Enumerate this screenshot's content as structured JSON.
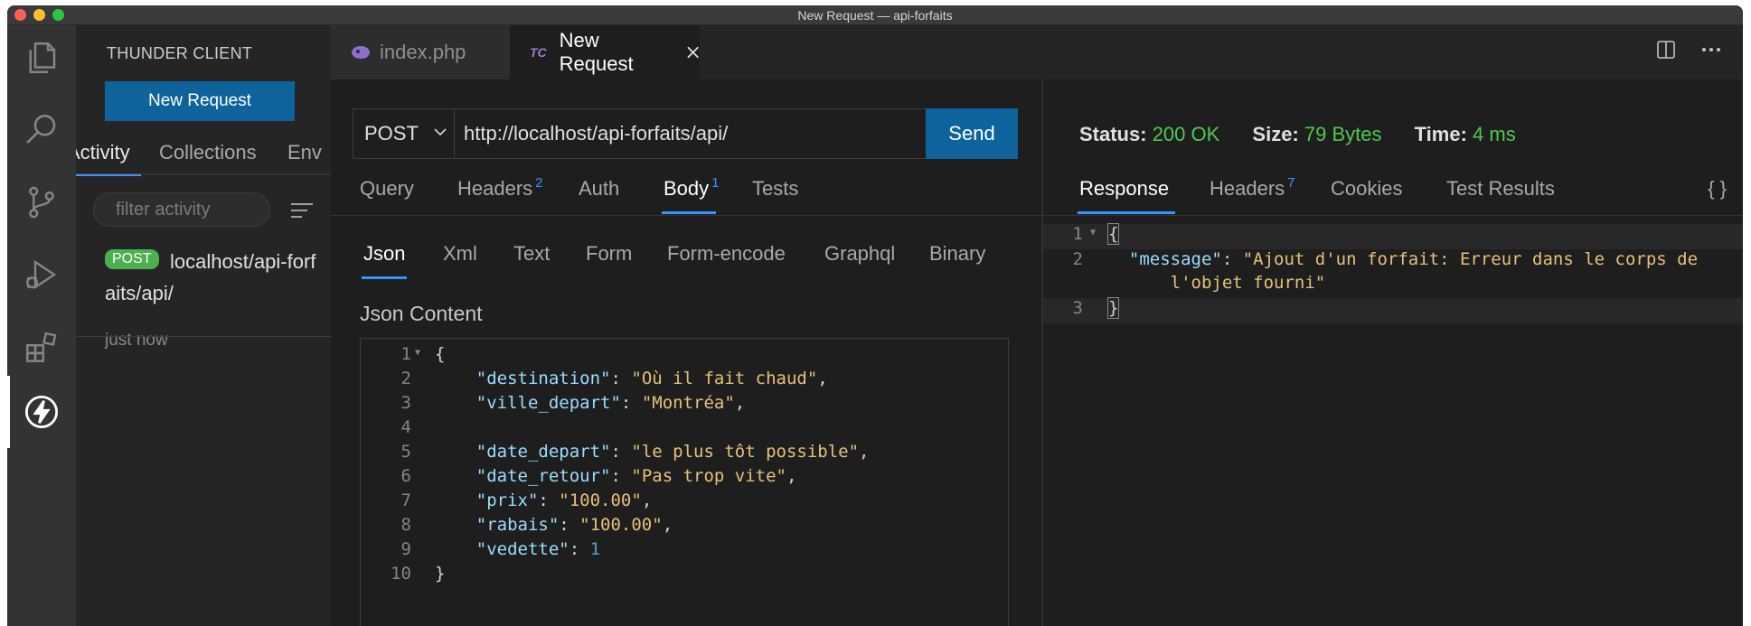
{
  "window": {
    "title": "New Request — api-forfaits"
  },
  "activity_bar": {
    "icons": [
      "files-icon",
      "search-icon",
      "source-control-icon",
      "run-debug-icon",
      "extensions-icon",
      "thunder-client-icon"
    ]
  },
  "sidebar": {
    "title": "THUNDER CLIENT",
    "new_request_label": "New Request",
    "tabs": [
      "Activity",
      "Collections",
      "Env"
    ],
    "filter_placeholder": "filter activity",
    "activity": {
      "method": "POST",
      "url": "localhost/api-forfaits/api/",
      "time": "just now"
    }
  },
  "editor_tabs": [
    {
      "label": "index.php",
      "icon": "php-icon"
    },
    {
      "label": "New Request",
      "icon": "tc-icon",
      "icon_text": "TC"
    }
  ],
  "request": {
    "method": "POST",
    "url": "http://localhost/api-forfaits/api/",
    "send_label": "Send",
    "tabs": [
      {
        "label": "Query",
        "count": ""
      },
      {
        "label": "Headers",
        "count": "2"
      },
      {
        "label": "Auth",
        "count": ""
      },
      {
        "label": "Body",
        "count": "1"
      },
      {
        "label": "Tests",
        "count": ""
      }
    ],
    "body_tabs": [
      "Json",
      "Xml",
      "Text",
      "Form",
      "Form-encode",
      "Graphql",
      "Binary"
    ],
    "json_label": "Json Content",
    "json_lines": [
      "{",
      "    \"destination\": \"Où il fait chaud\",",
      "    \"ville_depart\": \"Montréa\",",
      "",
      "    \"date_depart\": \"le plus tôt possible\",",
      "    \"date_retour\": \"Pas trop vite\",",
      "    \"prix\": \"100.00\",",
      "    \"rabais\": \"100.00\",",
      "    \"vedette\": 1",
      "}"
    ]
  },
  "response": {
    "status_label": "Status:",
    "status_value": "200 OK",
    "size_label": "Size:",
    "size_value": "79 Bytes",
    "time_label": "Time:",
    "time_value": "4 ms",
    "tabs": [
      {
        "label": "Response",
        "count": ""
      },
      {
        "label": "Headers",
        "count": "7"
      },
      {
        "label": "Cookies",
        "count": ""
      },
      {
        "label": "Test Results",
        "count": ""
      }
    ],
    "braces_label": "{ }",
    "lines": [
      "{",
      "  \"message\": \"Ajout d'un forfait: Erreur dans le corps de",
      "      l'objet fourni\"",
      "}"
    ],
    "line_numbers": [
      "1",
      "2",
      "",
      "3"
    ]
  },
  "colors": {
    "accent": "#3794ff",
    "button": "#0e639c",
    "status_ok": "#4ec94e",
    "post_badge": "#4caf50"
  }
}
